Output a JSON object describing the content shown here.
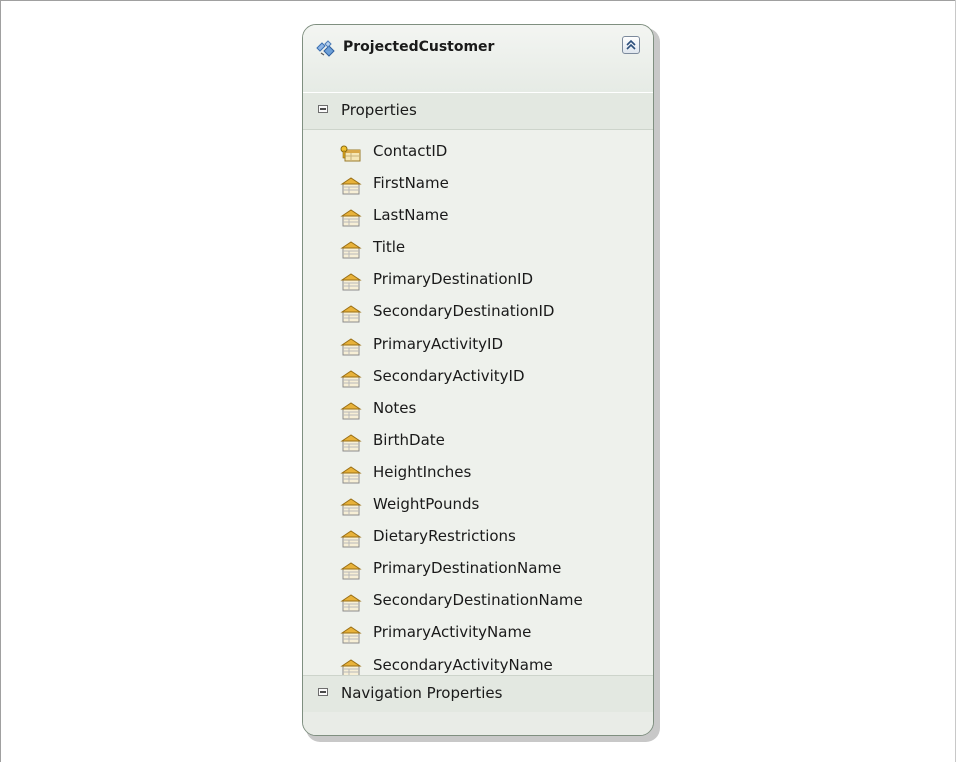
{
  "entity": {
    "name": "ProjectedCustomer",
    "icon": "entity-type-icon",
    "collapse_icon": "double-chevron-up-icon"
  },
  "sections": {
    "properties": {
      "label": "Properties",
      "toggle_icon": "minus-box-icon",
      "items": [
        {
          "label": "ContactID",
          "icon": "key-property-icon"
        },
        {
          "label": "FirstName",
          "icon": "property-icon"
        },
        {
          "label": "LastName",
          "icon": "property-icon"
        },
        {
          "label": "Title",
          "icon": "property-icon"
        },
        {
          "label": "PrimaryDestinationID",
          "icon": "property-icon"
        },
        {
          "label": "SecondaryDestinationID",
          "icon": "property-icon"
        },
        {
          "label": "PrimaryActivityID",
          "icon": "property-icon"
        },
        {
          "label": "SecondaryActivityID",
          "icon": "property-icon"
        },
        {
          "label": "Notes",
          "icon": "property-icon"
        },
        {
          "label": "BirthDate",
          "icon": "property-icon"
        },
        {
          "label": "HeightInches",
          "icon": "property-icon"
        },
        {
          "label": "WeightPounds",
          "icon": "property-icon"
        },
        {
          "label": "DietaryRestrictions",
          "icon": "property-icon"
        },
        {
          "label": "PrimaryDestinationName",
          "icon": "property-icon"
        },
        {
          "label": "SecondaryDestinationName",
          "icon": "property-icon"
        },
        {
          "label": "PrimaryActivityName",
          "icon": "property-icon"
        },
        {
          "label": "SecondaryActivityName",
          "icon": "property-icon"
        }
      ]
    },
    "navigation": {
      "label": "Navigation Properties",
      "toggle_icon": "minus-box-icon"
    }
  },
  "colors": {
    "entity_background": "#eef1ec",
    "section_background": "#e3e8e1",
    "entity_border": "#7f8f80"
  }
}
